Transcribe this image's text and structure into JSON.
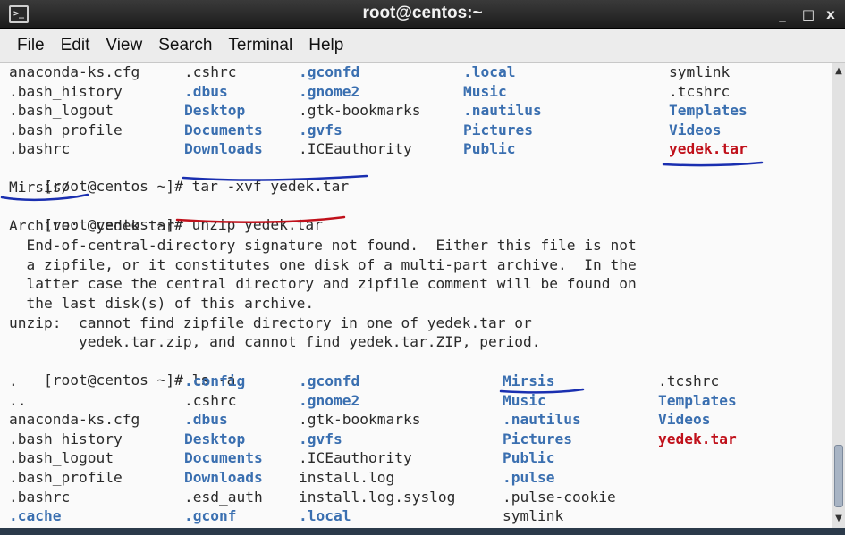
{
  "window": {
    "title": "root@centos:~",
    "icon": "terminal-icon"
  },
  "controls": {
    "minimize": "_",
    "maximize": "□",
    "close": "x"
  },
  "menu": [
    "File",
    "Edit",
    "View",
    "Search",
    "Terminal",
    "Help"
  ],
  "listing1": {
    "rows": [
      [
        {
          "t": "anaconda-ks.cfg",
          "c": "plain"
        },
        {
          "t": ".cshrc",
          "c": "plain"
        },
        {
          "t": ".gconfd",
          "c": "dir"
        },
        {
          "t": ".local",
          "c": "dir"
        },
        {
          "t": "symlink",
          "c": "plain"
        }
      ],
      [
        {
          "t": ".bash_history",
          "c": "plain"
        },
        {
          "t": ".dbus",
          "c": "dir"
        },
        {
          "t": ".gnome2",
          "c": "dir"
        },
        {
          "t": "Music",
          "c": "dir"
        },
        {
          "t": ".tcshrc",
          "c": "plain"
        }
      ],
      [
        {
          "t": ".bash_logout",
          "c": "plain"
        },
        {
          "t": "Desktop",
          "c": "dir"
        },
        {
          "t": ".gtk-bookmarks",
          "c": "plain"
        },
        {
          "t": ".nautilus",
          "c": "dir"
        },
        {
          "t": "Templates",
          "c": "dir"
        }
      ],
      [
        {
          "t": ".bash_profile",
          "c": "plain"
        },
        {
          "t": "Documents",
          "c": "dir"
        },
        {
          "t": ".gvfs",
          "c": "dir"
        },
        {
          "t": "Pictures",
          "c": "dir"
        },
        {
          "t": "Videos",
          "c": "dir"
        }
      ],
      [
        {
          "t": ".bashrc",
          "c": "plain"
        },
        {
          "t": "Downloads",
          "c": "dir"
        },
        {
          "t": ".ICEauthority",
          "c": "plain"
        },
        {
          "t": "Public",
          "c": "dir"
        },
        {
          "t": "yedek.tar",
          "c": "red"
        }
      ]
    ]
  },
  "cmd1": {
    "prompt": "[root@centos ~]# ",
    "command": "tar -xvf yedek.tar"
  },
  "out1": "Mirsis/",
  "cmd2": {
    "prompt": "[root@centos ~]# ",
    "command": "unzip yedek.tar"
  },
  "unzip_out": [
    "Archive:  yedek.tar",
    "  End-of-central-directory signature not found.  Either this file is not",
    "  a zipfile, or it constitutes one disk of a multi-part archive.  In the",
    "  latter case the central directory and zipfile comment will be found on",
    "  the last disk(s) of this archive.",
    "unzip:  cannot find zipfile directory in one of yedek.tar or",
    "        yedek.tar.zip, and cannot find yedek.tar.ZIP, period."
  ],
  "cmd3": {
    "prompt": "[root@centos ~]# ",
    "command": "ls -a"
  },
  "listing2": {
    "rows": [
      [
        {
          "t": ".",
          "c": "plain"
        },
        {
          "t": ".config",
          "c": "dir"
        },
        {
          "t": ".gconfd",
          "c": "dir"
        },
        {
          "t": "Mirsis",
          "c": "dir"
        },
        {
          "t": ".tcshrc",
          "c": "plain"
        }
      ],
      [
        {
          "t": "..",
          "c": "plain"
        },
        {
          "t": ".cshrc",
          "c": "plain"
        },
        {
          "t": ".gnome2",
          "c": "dir"
        },
        {
          "t": "Music",
          "c": "dir"
        },
        {
          "t": "Templates",
          "c": "dir"
        }
      ],
      [
        {
          "t": "anaconda-ks.cfg",
          "c": "plain"
        },
        {
          "t": ".dbus",
          "c": "dir"
        },
        {
          "t": ".gtk-bookmarks",
          "c": "plain"
        },
        {
          "t": ".nautilus",
          "c": "dir"
        },
        {
          "t": "Videos",
          "c": "dir"
        }
      ],
      [
        {
          "t": ".bash_history",
          "c": "plain"
        },
        {
          "t": "Desktop",
          "c": "dir"
        },
        {
          "t": ".gvfs",
          "c": "dir"
        },
        {
          "t": "Pictures",
          "c": "dir"
        },
        {
          "t": "yedek.tar",
          "c": "red"
        }
      ],
      [
        {
          "t": ".bash_logout",
          "c": "plain"
        },
        {
          "t": "Documents",
          "c": "dir"
        },
        {
          "t": ".ICEauthority",
          "c": "plain"
        },
        {
          "t": "Public",
          "c": "dir"
        },
        {
          "t": "",
          "c": "plain"
        }
      ],
      [
        {
          "t": ".bash_profile",
          "c": "plain"
        },
        {
          "t": "Downloads",
          "c": "dir"
        },
        {
          "t": "install.log",
          "c": "plain"
        },
        {
          "t": ".pulse",
          "c": "dir"
        },
        {
          "t": "",
          "c": "plain"
        }
      ],
      [
        {
          "t": ".bashrc",
          "c": "plain"
        },
        {
          "t": ".esd_auth",
          "c": "plain"
        },
        {
          "t": "install.log.syslog",
          "c": "plain"
        },
        {
          "t": ".pulse-cookie",
          "c": "plain"
        },
        {
          "t": "",
          "c": "plain"
        }
      ],
      [
        {
          "t": ".cache",
          "c": "dir"
        },
        {
          "t": ".gconf",
          "c": "dir"
        },
        {
          "t": ".local",
          "c": "dir"
        },
        {
          "t": "symlink",
          "c": "plain"
        },
        {
          "t": "",
          "c": "plain"
        }
      ]
    ]
  },
  "colors": {
    "dir": "#3a6fb0",
    "red": "#c0101a",
    "pen_blue": "#1a2fb0",
    "pen_red": "#c0101a"
  }
}
